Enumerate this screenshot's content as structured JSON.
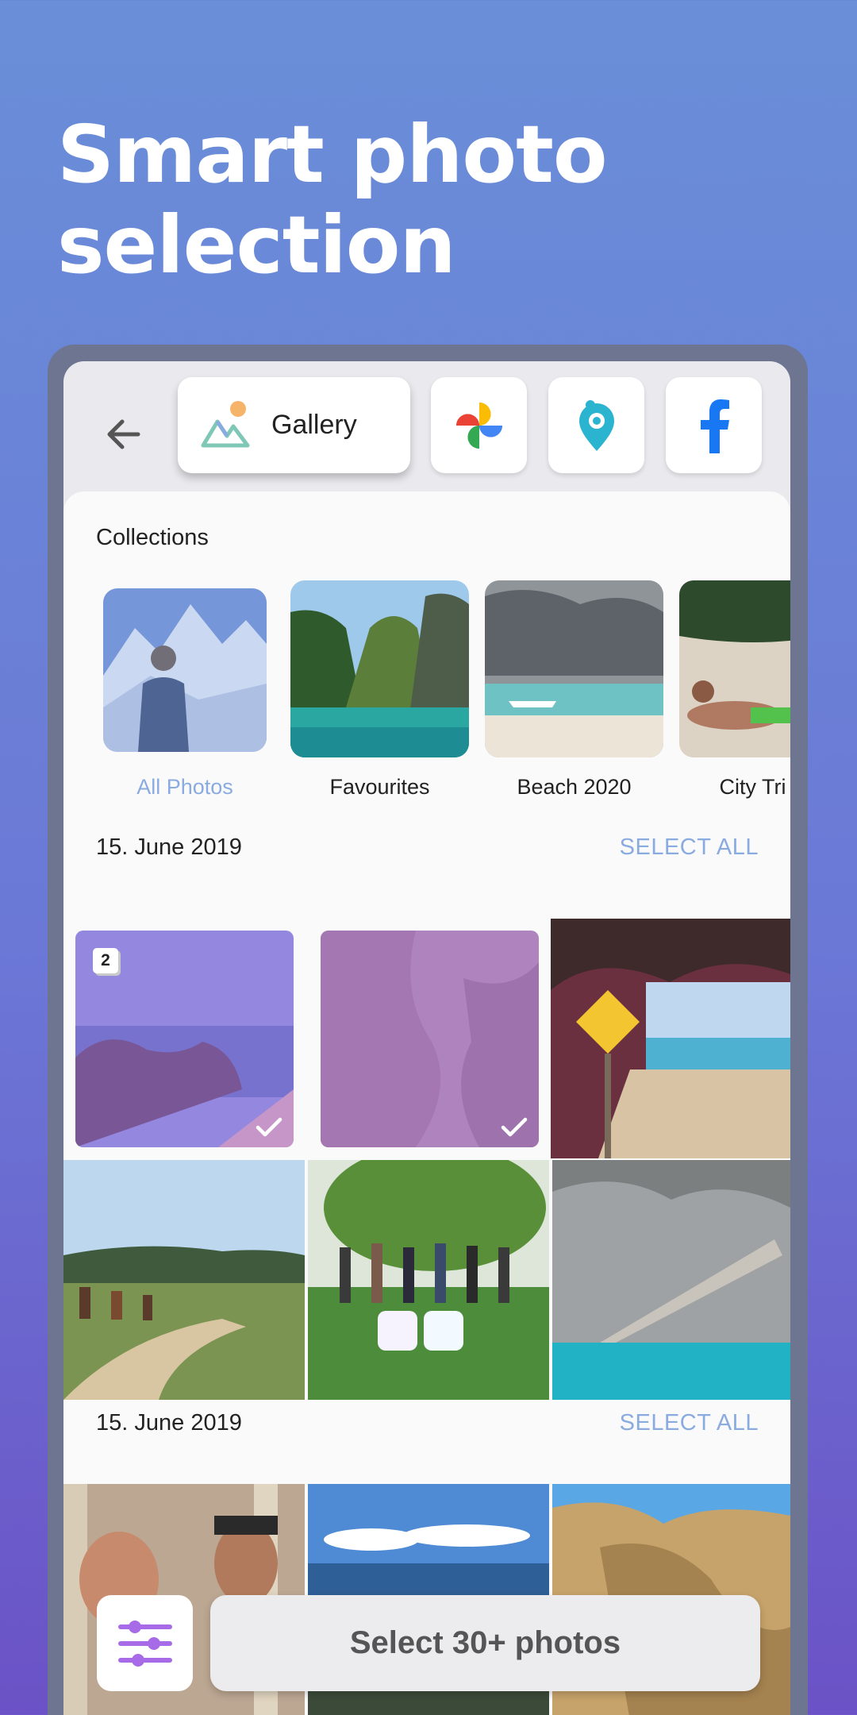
{
  "headline": "Smart photo selection",
  "sources": {
    "active_label": "Gallery",
    "icons": [
      "gallery-icon",
      "google-photos-icon",
      "polarsteps-icon",
      "facebook-icon"
    ]
  },
  "collections": {
    "title": "Collections",
    "items": [
      {
        "label": "All Photos",
        "active": true
      },
      {
        "label": "Favourites",
        "active": false
      },
      {
        "label": "Beach 2020",
        "active": false
      },
      {
        "label": "City Tri",
        "active": false
      }
    ]
  },
  "groups": [
    {
      "date": "15. June 2019",
      "action": "SELECT ALL"
    },
    {
      "date": "15. June 2019",
      "action": "SELECT ALL"
    }
  ],
  "selection": {
    "badge_count": "2"
  },
  "cta": {
    "label": "Select 30+ photos"
  },
  "colors": {
    "accent": "#8aabe0",
    "selected_overlay": "#aa6ee6",
    "filter_icon": "#a86be8"
  }
}
